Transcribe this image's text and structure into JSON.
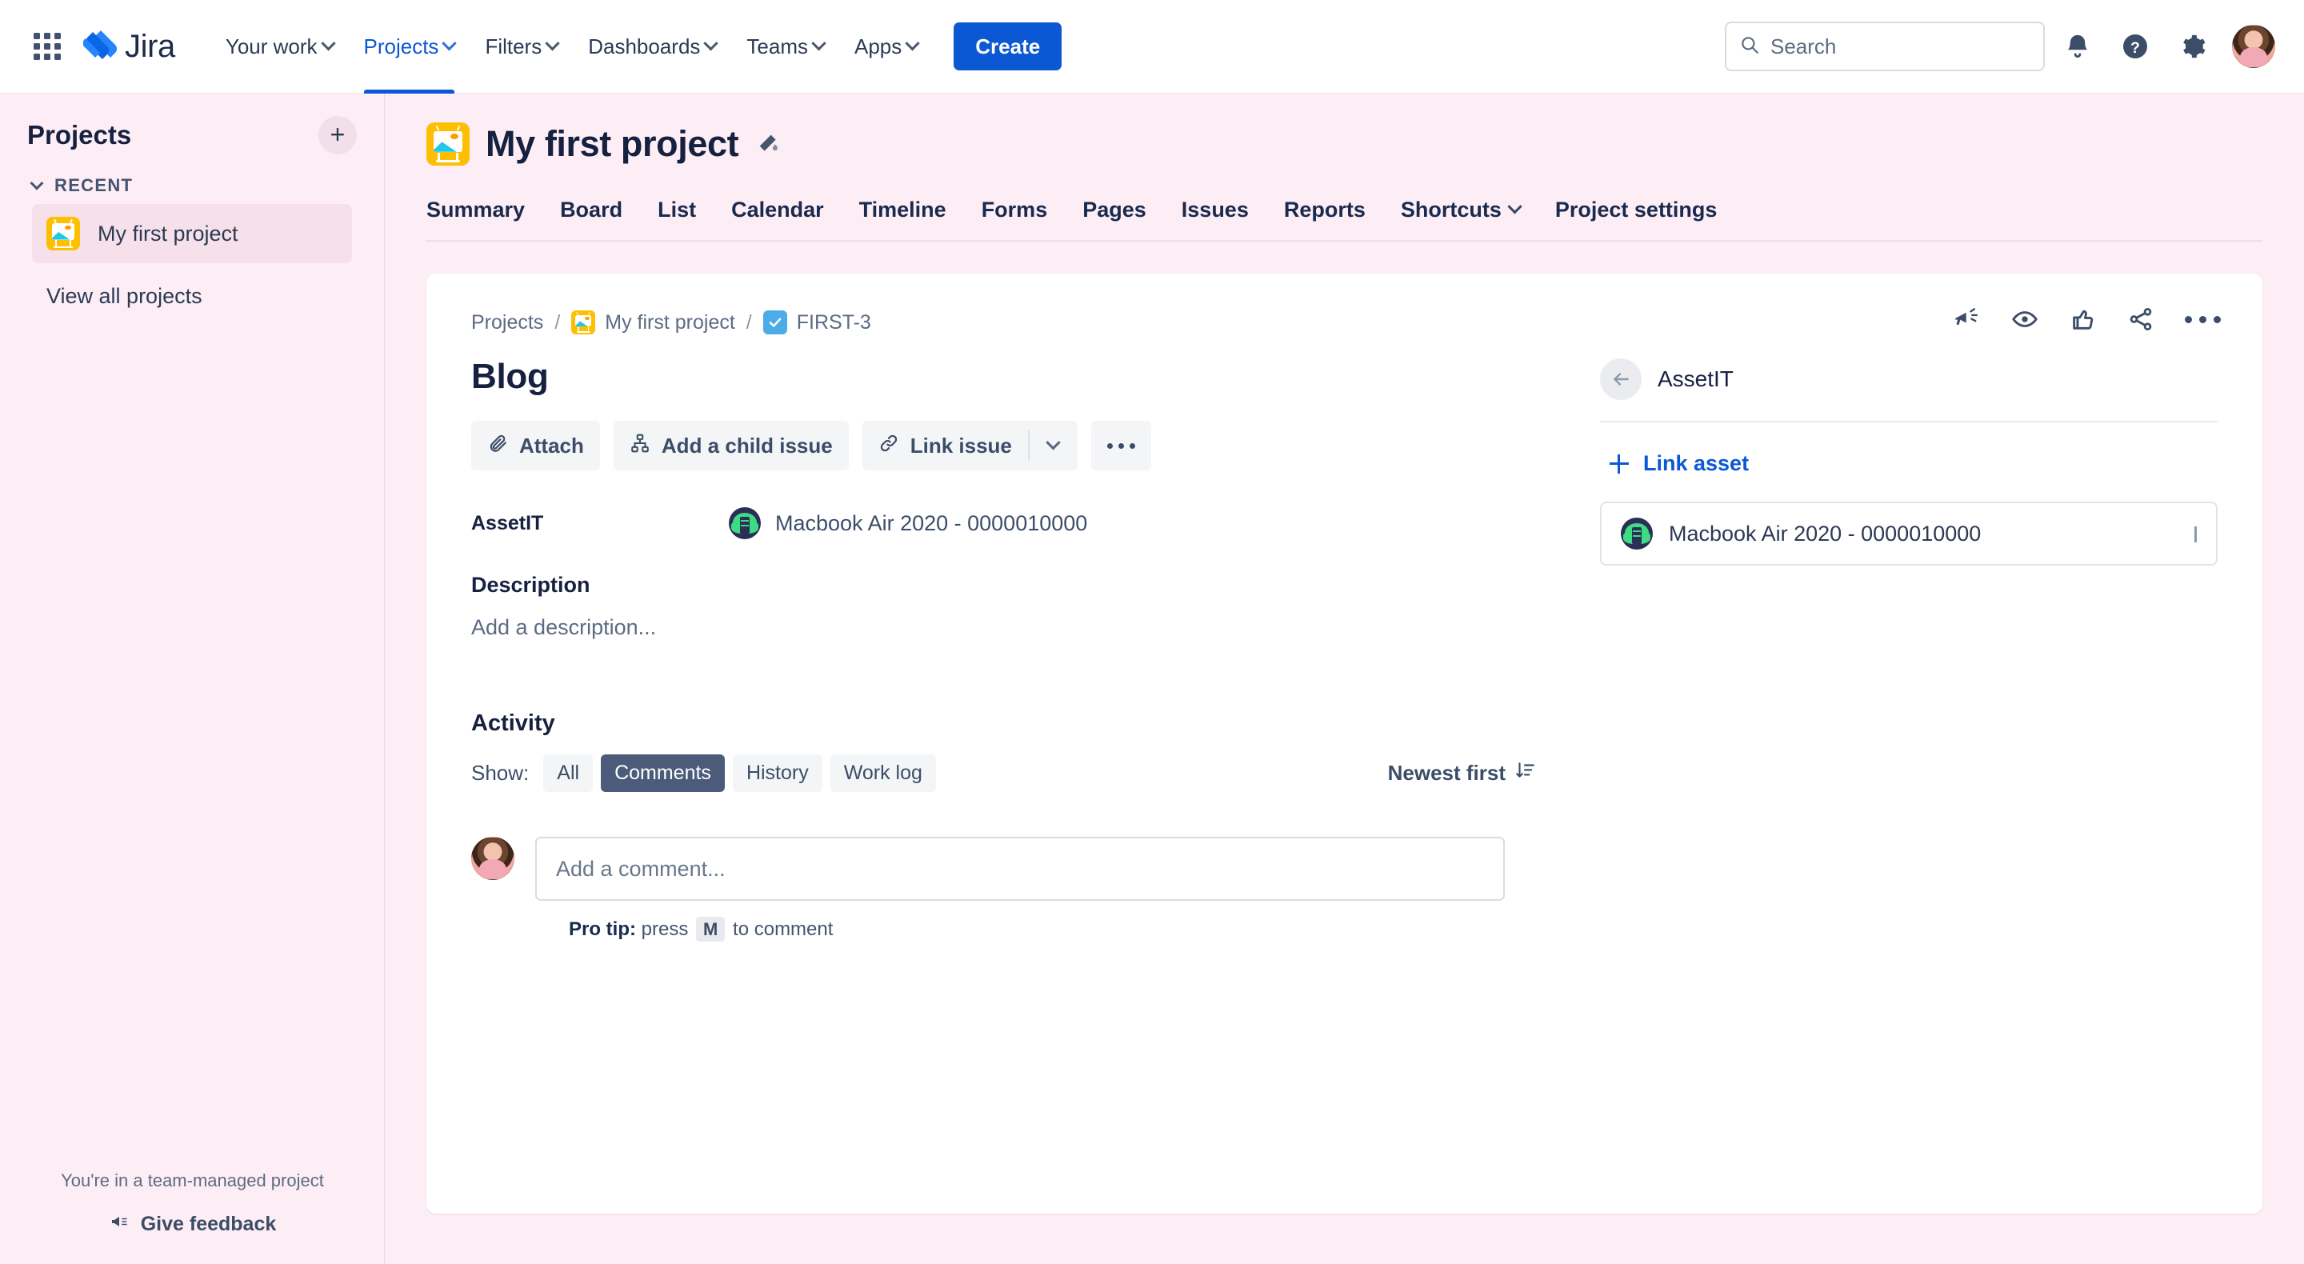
{
  "topnav": {
    "app_switcher": "app-switcher",
    "brand": "Jira",
    "items": [
      {
        "label": "Your work",
        "has_chevron": true,
        "active": false
      },
      {
        "label": "Projects",
        "has_chevron": true,
        "active": true
      },
      {
        "label": "Filters",
        "has_chevron": true,
        "active": false
      },
      {
        "label": "Dashboards",
        "has_chevron": true,
        "active": false
      },
      {
        "label": "Teams",
        "has_chevron": true,
        "active": false
      },
      {
        "label": "Apps",
        "has_chevron": true,
        "active": false
      }
    ],
    "create_label": "Create",
    "search_placeholder": "Search",
    "search_value": "",
    "icons": [
      "notifications-icon",
      "help-icon",
      "settings-icon",
      "profile-avatar"
    ]
  },
  "sidebar": {
    "title": "Projects",
    "add_label": "+",
    "section": {
      "label": "RECENT",
      "expanded": true
    },
    "items": [
      {
        "label": "My first project",
        "selected": true
      }
    ],
    "view_all_label": "View all projects",
    "footer_note": "You're in a team-managed project",
    "feedback_label": "Give feedback"
  },
  "project": {
    "title": "My first project",
    "tabs": [
      {
        "label": "Summary",
        "has_chevron": false
      },
      {
        "label": "Board",
        "has_chevron": false
      },
      {
        "label": "List",
        "has_chevron": false
      },
      {
        "label": "Calendar",
        "has_chevron": false
      },
      {
        "label": "Timeline",
        "has_chevron": false
      },
      {
        "label": "Forms",
        "has_chevron": false
      },
      {
        "label": "Pages",
        "has_chevron": false
      },
      {
        "label": "Issues",
        "has_chevron": false
      },
      {
        "label": "Reports",
        "has_chevron": false
      },
      {
        "label": "Shortcuts",
        "has_chevron": true
      },
      {
        "label": "Project settings",
        "has_chevron": false
      }
    ]
  },
  "issue": {
    "breadcrumb": {
      "projects": "Projects",
      "project": "My first project",
      "key": "FIRST-3",
      "separator": "/"
    },
    "title": "Blog",
    "actions": {
      "attach": "Attach",
      "add_child": "Add a child issue",
      "link_issue": "Link issue",
      "more": "•••"
    },
    "fields": [
      {
        "label": "AssetIT",
        "value": "Macbook Air 2020 - 0000010000"
      }
    ],
    "description": {
      "heading": "Description",
      "placeholder": "Add a description..."
    },
    "activity": {
      "heading": "Activity",
      "show_label": "Show:",
      "filters": [
        {
          "label": "All",
          "active": false
        },
        {
          "label": "Comments",
          "active": true
        },
        {
          "label": "History",
          "active": false
        },
        {
          "label": "Work log",
          "active": false
        }
      ],
      "sort_label": "Newest first"
    },
    "comment": {
      "placeholder": "Add a comment...",
      "value": "",
      "protip_prefix": "Pro tip:",
      "protip_press": "press",
      "protip_key": "M",
      "protip_suffix": "to comment"
    },
    "tools": [
      "megaphone-icon",
      "watch-eye-icon",
      "thumbs-up-icon",
      "share-icon",
      "more-actions-icon"
    ]
  },
  "right_panel": {
    "title": "AssetIT",
    "back_label": "back-arrow",
    "link_asset_label": "Link asset",
    "assets": [
      {
        "name": "Macbook Air 2020 - 0000010000"
      }
    ]
  },
  "colors": {
    "page_background": "#fdeef5",
    "accent_blue": "#0c57d3",
    "text_dark": "#162040",
    "text_muted": "#5d6b82",
    "chip_active": "#4c5b7a",
    "project_icon": "#fdbf00",
    "task_icon": "#4bade8",
    "asset_green": "#3ddc84"
  }
}
